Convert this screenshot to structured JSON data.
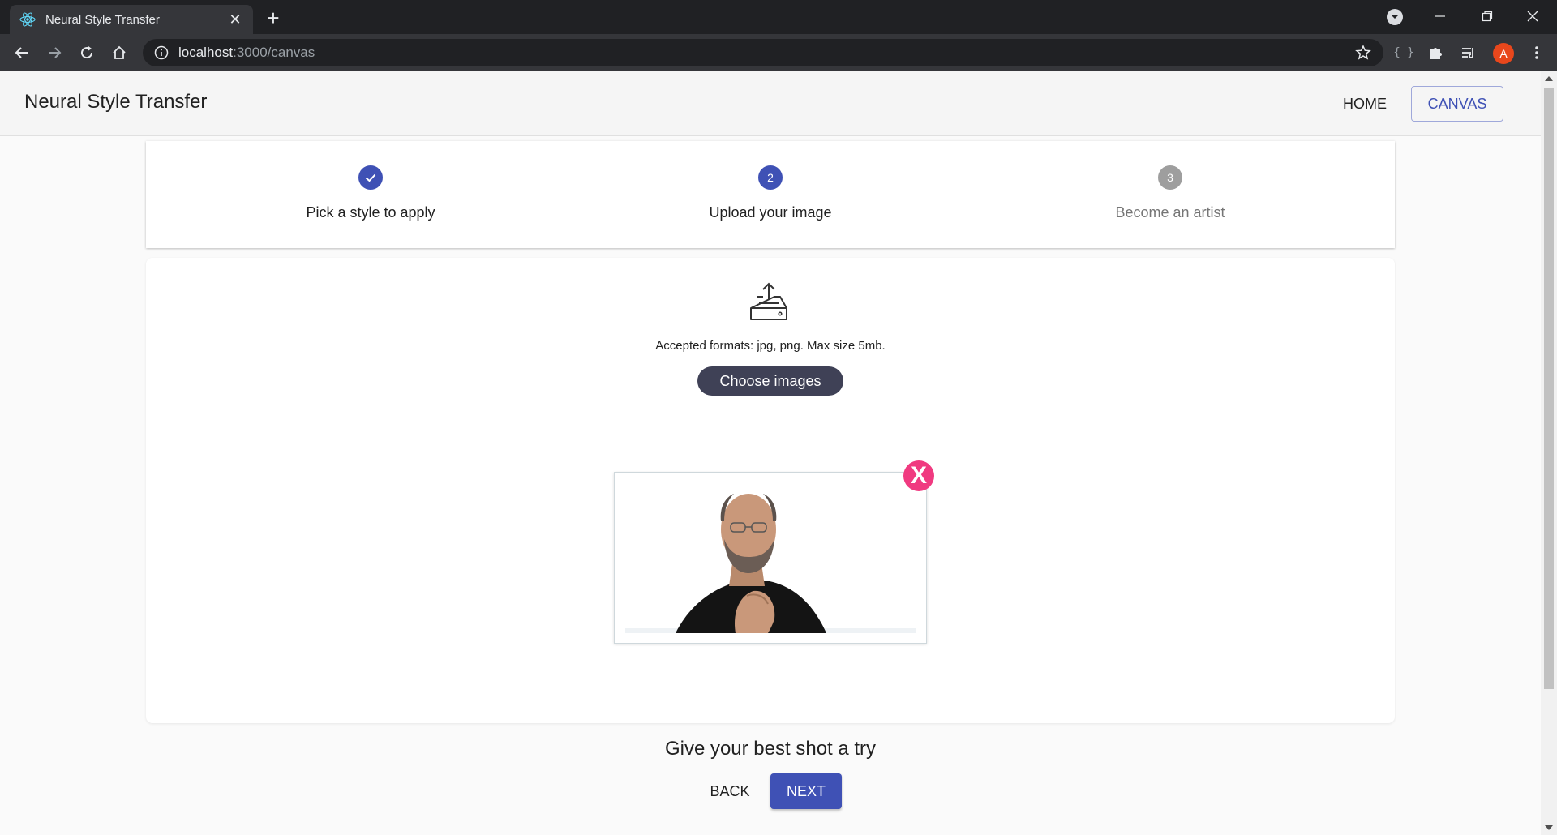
{
  "browser": {
    "tab_title": "Neural Style Transfer",
    "address_host": "localhost",
    "address_path": ":3000/canvas",
    "profile_initial": "A"
  },
  "app": {
    "title": "Neural Style Transfer",
    "nav": {
      "home": "HOME",
      "canvas": "CANVAS"
    }
  },
  "stepper": {
    "steps": [
      {
        "label": "Pick a style to apply",
        "state": "completed",
        "icon": "check-icon"
      },
      {
        "label": "Upload your image",
        "state": "active",
        "number": "2"
      },
      {
        "label": "Become an artist",
        "state": "pending",
        "number": "3"
      }
    ]
  },
  "upload": {
    "icon": "inbox-upload-icon",
    "formats_text": "Accepted formats: jpg, png. Max size 5mb.",
    "choose_button": "Choose images",
    "remove_label": "X"
  },
  "footer": {
    "tagline": "Give your best shot a try",
    "back": "BACK",
    "next": "NEXT"
  },
  "colors": {
    "primary": "#3f51b5",
    "remove": "#f03a80",
    "choose_button": "#3f4156",
    "pending_step": "#9e9e9e"
  }
}
